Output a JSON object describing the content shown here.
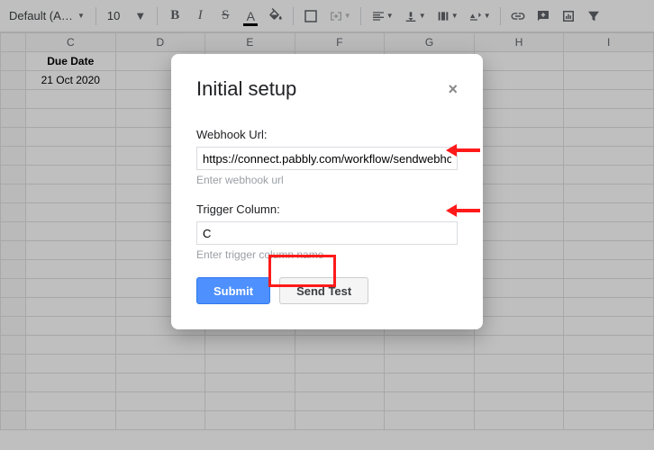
{
  "toolbar": {
    "font_name": "Default (Ari...",
    "font_size": "10",
    "colors": {
      "text_underline": "#000000"
    }
  },
  "grid": {
    "columns": [
      "C",
      "D",
      "E",
      "F",
      "G",
      "H",
      "I"
    ],
    "rows": [
      {
        "c": "Due Date"
      },
      {
        "c": "21 Oct 2020"
      },
      {
        "c": ""
      },
      {
        "c": ""
      },
      {
        "c": ""
      },
      {
        "c": ""
      },
      {
        "c": ""
      },
      {
        "c": ""
      },
      {
        "c": ""
      },
      {
        "c": ""
      },
      {
        "c": ""
      },
      {
        "c": ""
      },
      {
        "c": ""
      },
      {
        "c": ""
      },
      {
        "c": ""
      },
      {
        "c": ""
      },
      {
        "c": ""
      },
      {
        "c": ""
      },
      {
        "c": ""
      },
      {
        "c": ""
      }
    ]
  },
  "modal": {
    "title": "Initial setup",
    "close_label": "×",
    "webhook": {
      "label": "Webhook Url:",
      "value": "https://connect.pabbly.com/workflow/sendwebhookdata/",
      "placeholder": "",
      "hint": "Enter webhook url"
    },
    "trigger": {
      "label": "Trigger Column:",
      "value": "C",
      "placeholder": "",
      "hint": "Enter trigger column name"
    },
    "submit_label": "Submit",
    "send_test_label": "Send Test"
  }
}
